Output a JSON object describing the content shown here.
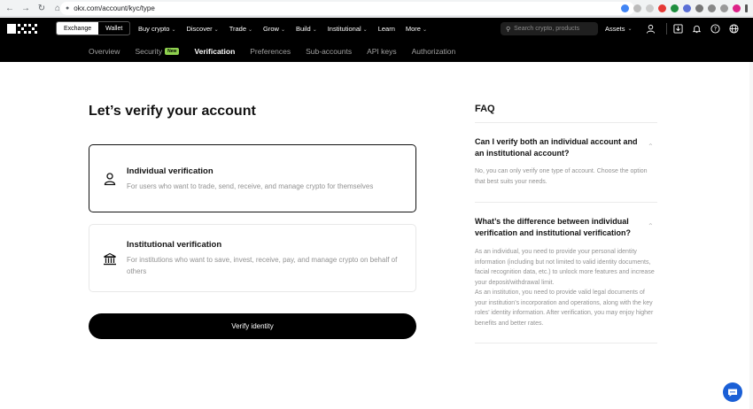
{
  "browser": {
    "url": "okx.com/account/kyc/type",
    "nav_icons": [
      "back-icon",
      "forward-icon",
      "reload-icon",
      "home-icon"
    ]
  },
  "topnav": {
    "segment": {
      "exchange": "Exchange",
      "wallet": "Wallet"
    },
    "menu": [
      {
        "label": "Buy crypto",
        "chevron": true
      },
      {
        "label": "Discover",
        "chevron": true
      },
      {
        "label": "Trade",
        "chevron": true
      },
      {
        "label": "Grow",
        "chevron": true
      },
      {
        "label": "Build",
        "chevron": true
      },
      {
        "label": "Institutional",
        "chevron": true
      },
      {
        "label": "Learn",
        "chevron": false
      },
      {
        "label": "More",
        "chevron": true
      }
    ],
    "search_placeholder": "Search crypto, products",
    "assets_label": "Assets"
  },
  "subnav": {
    "items": [
      {
        "label": "Overview"
      },
      {
        "label": "Security",
        "badge": "New"
      },
      {
        "label": "Verification",
        "active": true
      },
      {
        "label": "Preferences"
      },
      {
        "label": "Sub-accounts"
      },
      {
        "label": "API keys"
      },
      {
        "label": "Authorization"
      }
    ]
  },
  "main": {
    "title": "Let’s verify your account",
    "options": [
      {
        "title": "Individual verification",
        "description": "For users who want to trade, send, receive, and manage crypto for themselves",
        "icon": "person-icon",
        "selected": true
      },
      {
        "title": "Institutional verification",
        "description": "For institutions who want to save, invest, receive, pay, and manage crypto on behalf of others",
        "icon": "institution-icon",
        "selected": false
      }
    ],
    "verify_button": "Verify identity"
  },
  "faq": {
    "title": "FAQ",
    "items": [
      {
        "question": "Can I verify both an individual account and an institutional account?",
        "answer": "No, you can only verify one type of account. Choose the option that best suits your needs."
      },
      {
        "question": "What’s the difference between individual verification and institutional verification?",
        "answer_1": "As an individual, you need to provide your personal identity information (including but not limited to valid identity documents, facial recognition data, etc.) to unlock more features and increase your deposit/withdrawal limit.",
        "answer_2": "As an institution, you need to provide valid legal documents of your institution’s incorporation and operations, along with the key roles’ identity information. After verification, you may enjoy higher benefits and better rates."
      }
    ]
  },
  "colors": {
    "nav_bg": "#000000",
    "badge": "#8fd14f",
    "chat_fab": "#1a5fd6"
  }
}
